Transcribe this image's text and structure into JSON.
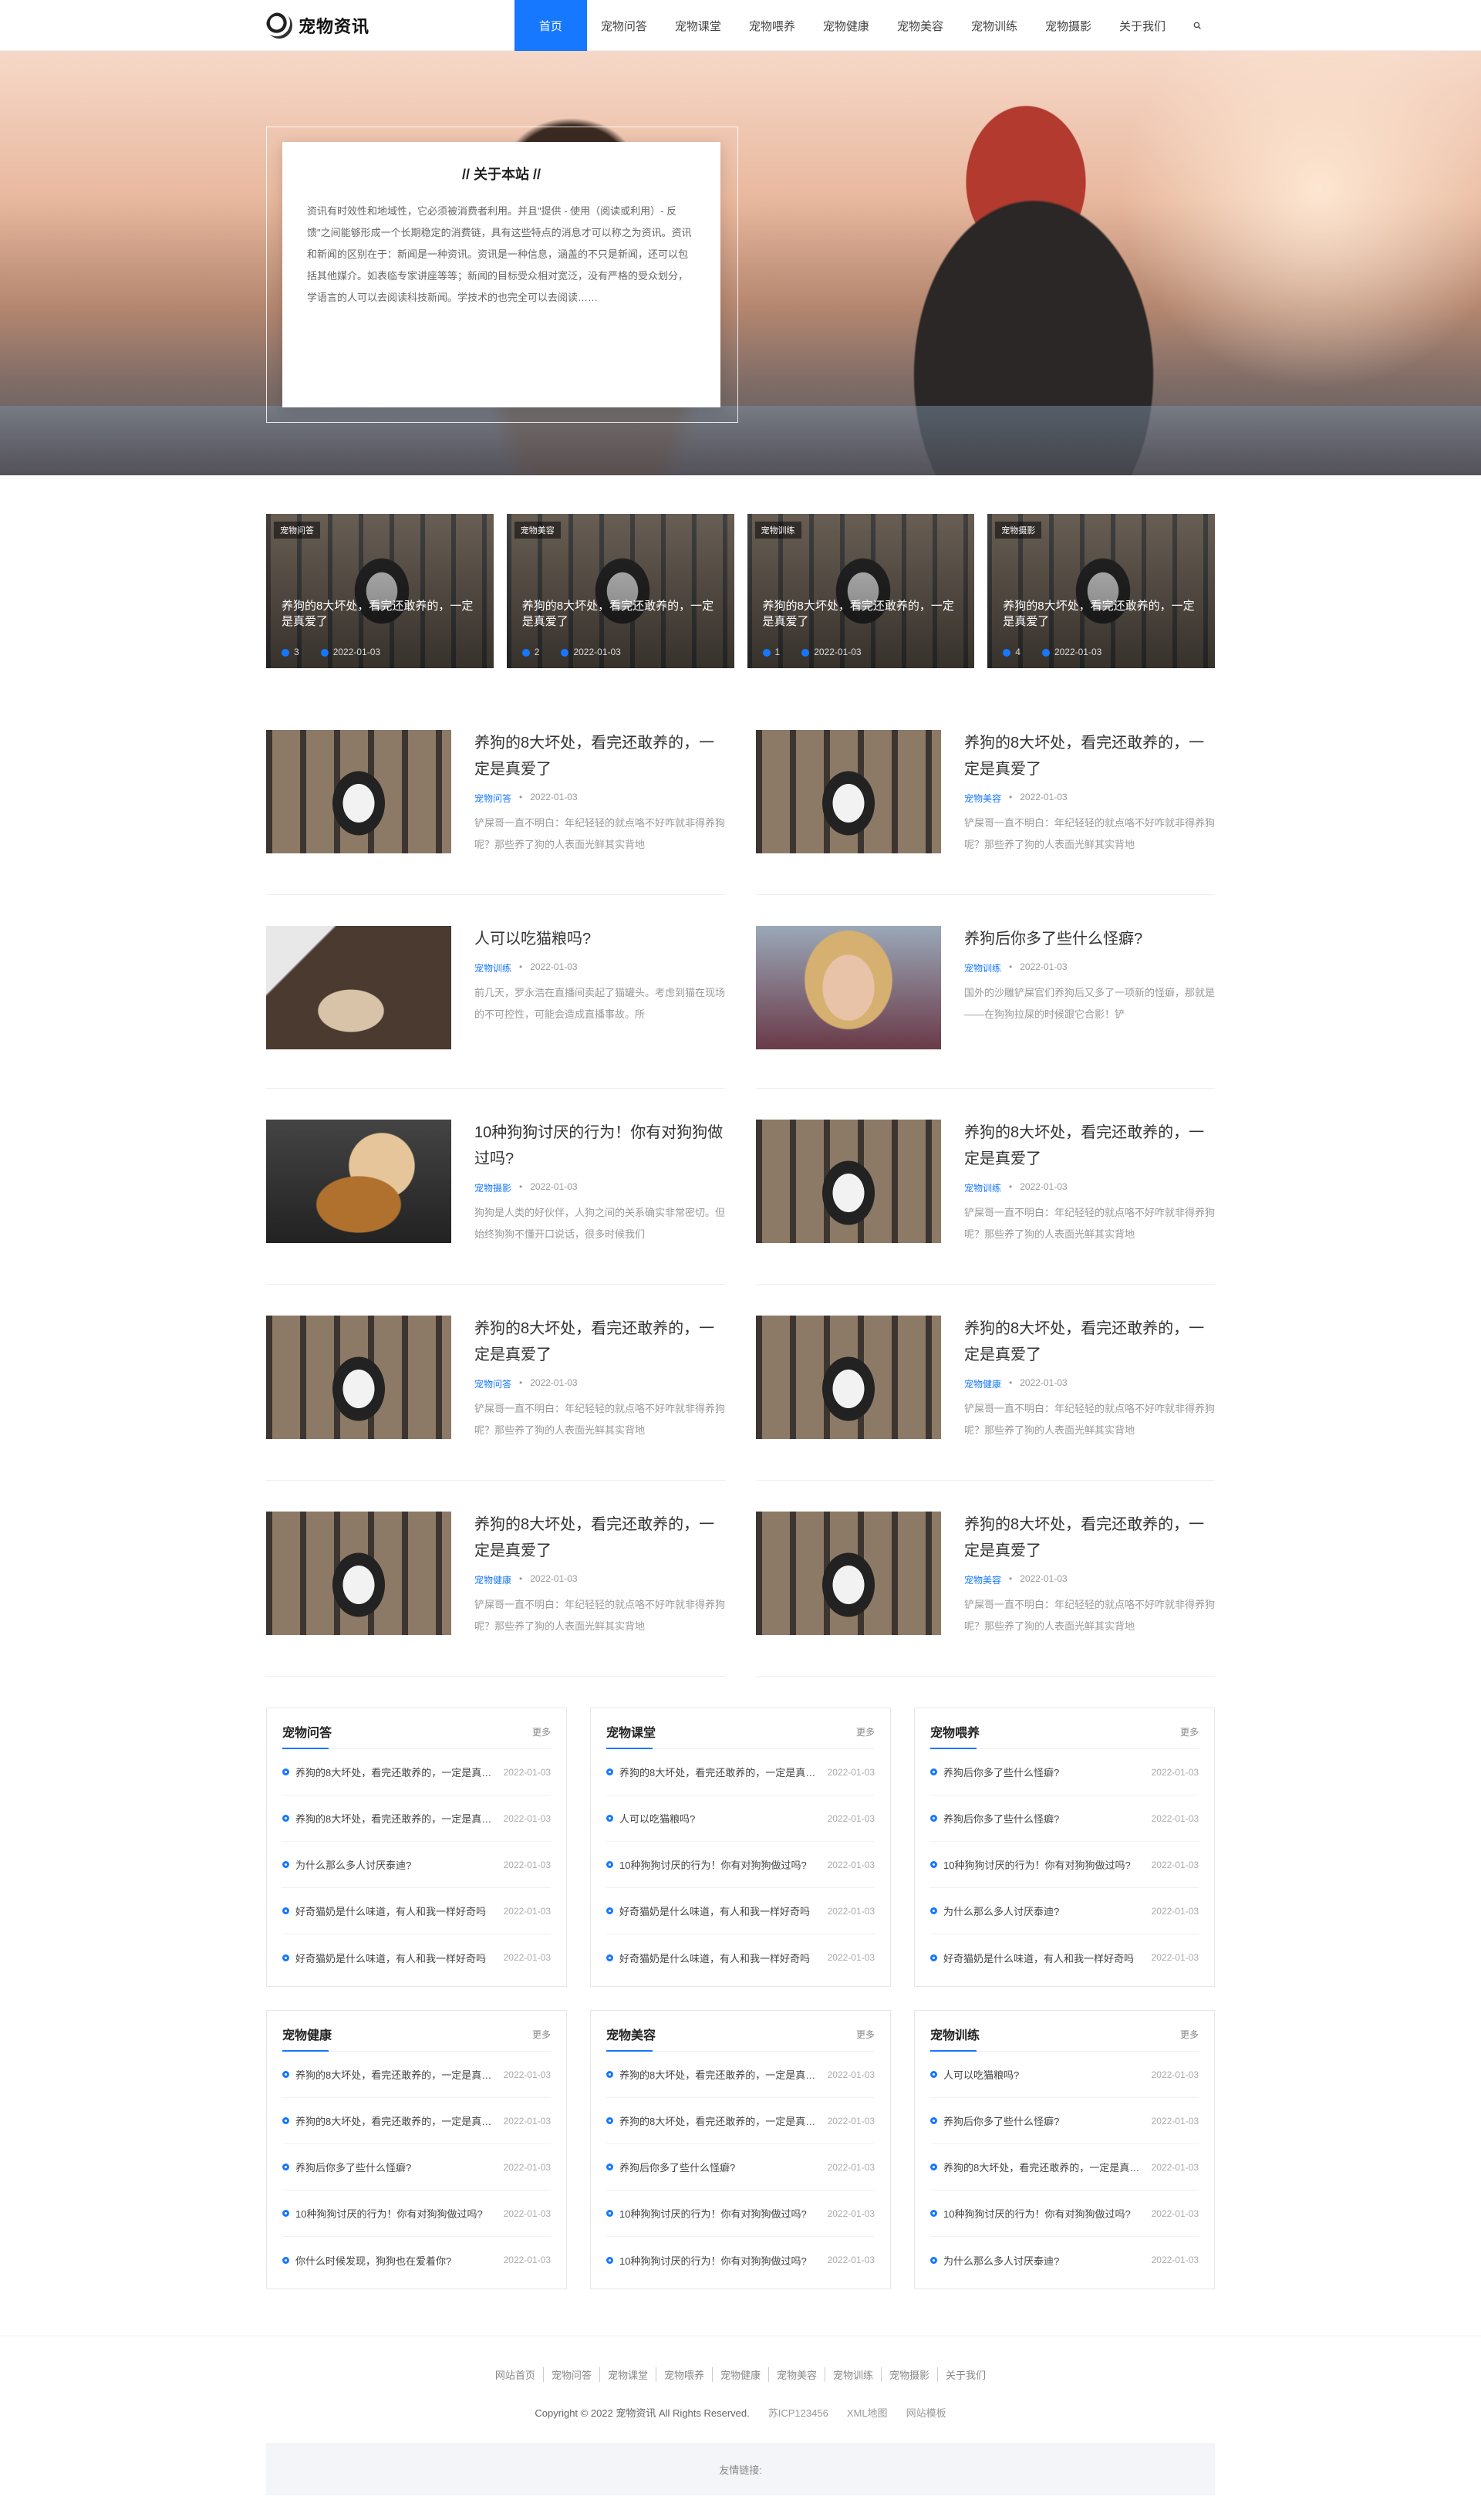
{
  "site": {
    "logo_text": "宠物资讯"
  },
  "nav": {
    "items": [
      "首页",
      "宠物问答",
      "宠物课堂",
      "宠物喂养",
      "宠物健康",
      "宠物美容",
      "宠物训练",
      "宠物摄影",
      "关于我们"
    ],
    "search_icon": "search-icon"
  },
  "about": {
    "title": "// 关于本站 //",
    "text": "资讯有时效性和地域性，它必须被消费者利用。并且\"提供 - 使用（阅读或利用）- 反馈\"之间能够形成一个长期稳定的消费链，具有这些特点的消息才可以称之为资讯。资讯和新闻的区别在于：新闻是一种资讯。资讯是一种信息，涵盖的不只是新闻，还可以包括其他媒介。如表临专家讲座等等；新闻的目标受众相对宽泛，没有严格的受众划分，学语言的人可以去阅读科技新闻。学技术的也完全可以去阅读……"
  },
  "featured": [
    {
      "tag": "宠物问答",
      "title": "养狗的8大坏处，看完还敢养的，一定是真爱了",
      "views": "3",
      "date": "2022-01-03"
    },
    {
      "tag": "宠物美容",
      "title": "养狗的8大坏处，看完还敢养的，一定是真爱了",
      "views": "2",
      "date": "2022-01-03"
    },
    {
      "tag": "宠物训练",
      "title": "养狗的8大坏处，看完还敢养的，一定是真爱了",
      "views": "1",
      "date": "2022-01-03"
    },
    {
      "tag": "宠物摄影",
      "title": "养狗的8大坏处，看完还敢养的，一定是真爱了",
      "views": "4",
      "date": "2022-01-03"
    }
  ],
  "articles": [
    {
      "thumb": "husky",
      "title": "养狗的8大坏处，看完还敢养的，一定是真爱了",
      "category": "宠物问答",
      "date": "2022-01-03",
      "excerpt": "铲屎哥一直不明白：年纪轻轻的就点咯不好咋就非得养狗呢？那些养了狗的人表面光鲜其实背地"
    },
    {
      "thumb": "husky",
      "title": "养狗的8大坏处，看完还敢养的，一定是真爱了",
      "category": "宠物美容",
      "date": "2022-01-03",
      "excerpt": "铲屎哥一直不明白：年纪轻轻的就点咯不好咋就非得养狗呢？那些养了狗的人表面光鲜其实背地"
    },
    {
      "thumb": "cat",
      "title": "人可以吃猫粮吗?",
      "category": "宠物训练",
      "date": "2022-01-03",
      "excerpt": "前几天，罗永浩在直播间卖起了猫罐头。考虑到猫在现场的不可控性，可能会造成直播事故。所"
    },
    {
      "thumb": "woman",
      "title": "养狗后你多了些什么怪癖?",
      "category": "宠物训练",
      "date": "2022-01-03",
      "excerpt": "国外的沙雕铲屎官们养狗后又多了一项新的怪癖，那就是——在狗狗拉屎的时候跟它合影！铲"
    },
    {
      "thumb": "puppy",
      "title": "10种狗狗讨厌的行为！你有对狗狗做过吗?",
      "category": "宠物摄影",
      "date": "2022-01-03",
      "excerpt": "狗狗是人类的好伙伴，人狗之间的关系确实非常密切。但始终狗狗不懂开口说话，很多时候我们"
    },
    {
      "thumb": "husky",
      "title": "养狗的8大坏处，看完还敢养的，一定是真爱了",
      "category": "宠物训练",
      "date": "2022-01-03",
      "excerpt": "铲屎哥一直不明白：年纪轻轻的就点咯不好咋就非得养狗呢？那些养了狗的人表面光鲜其实背地"
    },
    {
      "thumb": "husky",
      "title": "养狗的8大坏处，看完还敢养的，一定是真爱了",
      "category": "宠物问答",
      "date": "2022-01-03",
      "excerpt": "铲屎哥一直不明白：年纪轻轻的就点咯不好咋就非得养狗呢？那些养了狗的人表面光鲜其实背地"
    },
    {
      "thumb": "husky",
      "title": "养狗的8大坏处，看完还敢养的，一定是真爱了",
      "category": "宠物健康",
      "date": "2022-01-03",
      "excerpt": "铲屎哥一直不明白：年纪轻轻的就点咯不好咋就非得养狗呢？那些养了狗的人表面光鲜其实背地"
    },
    {
      "thumb": "husky",
      "title": "养狗的8大坏处，看完还敢养的，一定是真爱了",
      "category": "宠物健康",
      "date": "2022-01-03",
      "excerpt": "铲屎哥一直不明白：年纪轻轻的就点咯不好咋就非得养狗呢？那些养了狗的人表面光鲜其实背地"
    },
    {
      "thumb": "husky",
      "title": "养狗的8大坏处，看完还敢养的，一定是真爱了",
      "category": "宠物美容",
      "date": "2022-01-03",
      "excerpt": "铲屎哥一直不明白：年纪轻轻的就点咯不好咋就非得养狗呢？那些养了狗的人表面光鲜其实背地"
    }
  ],
  "boxes": [
    {
      "title": "宠物问答",
      "more": "更多",
      "items": [
        {
          "text": "养狗的8大坏处，看完还敢养的，一定是真爱了",
          "date": "2022-01-03"
        },
        {
          "text": "养狗的8大坏处，看完还敢养的，一定是真爱了",
          "date": "2022-01-03"
        },
        {
          "text": "为什么那么多人讨厌泰迪?",
          "date": "2022-01-03"
        },
        {
          "text": "好奇猫奶是什么味道，有人和我一样好奇吗",
          "date": "2022-01-03"
        },
        {
          "text": "好奇猫奶是什么味道，有人和我一样好奇吗",
          "date": "2022-01-03"
        }
      ]
    },
    {
      "title": "宠物课堂",
      "more": "更多",
      "items": [
        {
          "text": "养狗的8大坏处，看完还敢养的，一定是真爱了",
          "date": "2022-01-03"
        },
        {
          "text": "人可以吃猫粮吗?",
          "date": "2022-01-03"
        },
        {
          "text": "10种狗狗讨厌的行为！你有对狗狗做过吗?",
          "date": "2022-01-03"
        },
        {
          "text": "好奇猫奶是什么味道，有人和我一样好奇吗",
          "date": "2022-01-03"
        },
        {
          "text": "好奇猫奶是什么味道，有人和我一样好奇吗",
          "date": "2022-01-03"
        }
      ]
    },
    {
      "title": "宠物喂养",
      "more": "更多",
      "items": [
        {
          "text": "养狗后你多了些什么怪癖?",
          "date": "2022-01-03"
        },
        {
          "text": "养狗后你多了些什么怪癖?",
          "date": "2022-01-03"
        },
        {
          "text": "10种狗狗讨厌的行为！你有对狗狗做过吗?",
          "date": "2022-01-03"
        },
        {
          "text": "为什么那么多人讨厌泰迪?",
          "date": "2022-01-03"
        },
        {
          "text": "好奇猫奶是什么味道，有人和我一样好奇吗",
          "date": "2022-01-03"
        }
      ]
    },
    {
      "title": "宠物健康",
      "more": "更多",
      "items": [
        {
          "text": "养狗的8大坏处，看完还敢养的，一定是真爱了",
          "date": "2022-01-03"
        },
        {
          "text": "养狗的8大坏处，看完还敢养的，一定是真爱了",
          "date": "2022-01-03"
        },
        {
          "text": "养狗后你多了些什么怪癖?",
          "date": "2022-01-03"
        },
        {
          "text": "10种狗狗讨厌的行为！你有对狗狗做过吗?",
          "date": "2022-01-03"
        },
        {
          "text": "你什么时候发现，狗狗也在爱着你?",
          "date": "2022-01-03"
        }
      ]
    },
    {
      "title": "宠物美容",
      "more": "更多",
      "items": [
        {
          "text": "养狗的8大坏处，看完还敢养的，一定是真爱了",
          "date": "2022-01-03"
        },
        {
          "text": "养狗的8大坏处，看完还敢养的，一定是真爱了",
          "date": "2022-01-03"
        },
        {
          "text": "养狗后你多了些什么怪癖?",
          "date": "2022-01-03"
        },
        {
          "text": "10种狗狗讨厌的行为！你有对狗狗做过吗?",
          "date": "2022-01-03"
        },
        {
          "text": "10种狗狗讨厌的行为！你有对狗狗做过吗?",
          "date": "2022-01-03"
        }
      ]
    },
    {
      "title": "宠物训练",
      "more": "更多",
      "items": [
        {
          "text": "人可以吃猫粮吗?",
          "date": "2022-01-03"
        },
        {
          "text": "养狗后你多了些什么怪癖?",
          "date": "2022-01-03"
        },
        {
          "text": "养狗的8大坏处，看完还敢养的，一定是真爱了",
          "date": "2022-01-03"
        },
        {
          "text": "10种狗狗讨厌的行为！你有对狗狗做过吗?",
          "date": "2022-01-03"
        },
        {
          "text": "为什么那么多人讨厌泰迪?",
          "date": "2022-01-03"
        }
      ]
    }
  ],
  "footer": {
    "links": [
      "网站首页",
      "宠物问答",
      "宠物课堂",
      "宠物喂养",
      "宠物健康",
      "宠物美容",
      "宠物训练",
      "宠物摄影",
      "关于我们"
    ],
    "copyright": "Copyright © 2022 宠物资讯 All Rights Reserved.",
    "icp": "苏ICP123456",
    "xml_map": "XML地图",
    "template": "网站模板",
    "friends_label": "友情链接:"
  },
  "colors": {
    "accent": "#1677ff"
  }
}
